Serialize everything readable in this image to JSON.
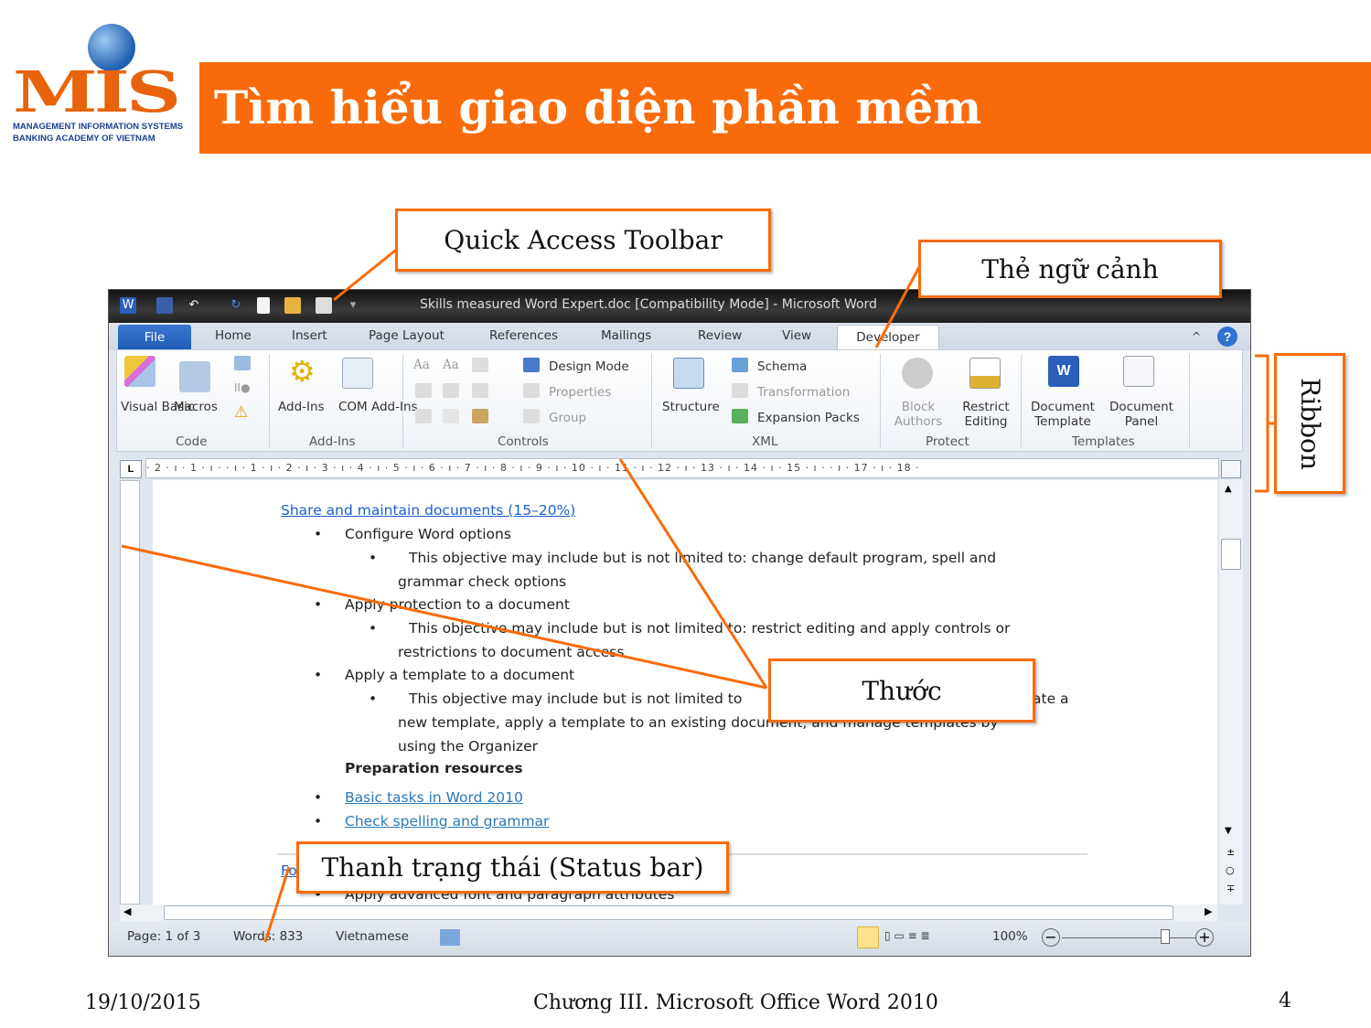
{
  "slide": {
    "title": "Tìm hiểu giao diện phần mềm",
    "footer_date": "19/10/2015",
    "footer_center": "Chương III. Microsoft Office Word 2010",
    "page_number": "4",
    "accent": "#f96b0a"
  },
  "logo": {
    "text": "MIS",
    "line1": "MANAGEMENT INFORMATION SYSTEMS",
    "line2": "BANKING ACADEMY OF VIETNAM"
  },
  "callouts": {
    "qat": "Quick Access Toolbar",
    "contextual": "Thẻ ngữ cảnh",
    "ribbon": "Ribbon",
    "ruler": "Thước",
    "statusbar": "Thanh trạng thái (Status bar)"
  },
  "word": {
    "title": "Skills measured Word Expert.doc [Compatibility Mode]  -  Microsoft Word",
    "qat_icons": [
      "word-icon",
      "save-icon",
      "undo-icon",
      "redo-icon",
      "new-icon",
      "open-icon",
      "print-preview-icon",
      "customize-icon"
    ],
    "tabs": [
      "File",
      "Home",
      "Insert",
      "Page Layout",
      "References",
      "Mailings",
      "Review",
      "View",
      "Developer"
    ],
    "ribbon": {
      "code": {
        "label": "Code",
        "visual_basic": "Visual Basic",
        "macros": "Macros"
      },
      "addins": {
        "label": "Add-Ins",
        "addins": "Add-Ins",
        "com": "COM Add-Ins"
      },
      "controls": {
        "label": "Controls",
        "design_mode": "Design Mode",
        "properties": "Properties",
        "group": "Group",
        "aa1": "Aa",
        "aa2": "Aa"
      },
      "xml": {
        "label": "XML",
        "structure": "Structure",
        "schema": "Schema",
        "transformation": "Transformation",
        "expansion": "Expansion Packs"
      },
      "protect": {
        "label": "Protect",
        "block": "Block Authors",
        "restrict": "Restrict Editing"
      },
      "templates": {
        "label": "Templates",
        "doc_template": "Document Template",
        "doc_panel": "Document Panel"
      }
    },
    "ruler": "· 2 · ı · 1 · ı ·   · ı · 1 · ı · 2 · ı · 3 · ı · 4 · ı · 5 · ı · 6 · ı · 7 · ı · 8 · ı · 9 · ı · 10 · ı · 11 · ı · 12 · ı · 13 · ı · 14 · ı · 15 · ı ·   · ı · 17 · ı · 18 ·",
    "doc": {
      "heading": "Share and maintain documents (15–20%)",
      "b1": "Configure Word options",
      "b1s": "This objective may include but is not limited to: change default program, spell and",
      "b1s2": "grammar check options",
      "b2": "Apply protection to a document",
      "b2s": "This objective may include but is not limited to: restrict editing and apply controls or",
      "b2s2": "restrictions to document access",
      "b3": "Apply a template to a document",
      "b3s": "This objective may include but is not limited to",
      "b3s_end": "ate a",
      "b3s2": "new template, apply a template to an existing document, and manage templates by",
      "b3s3": "using the Organizer",
      "prep": "Preparation resources",
      "l1": "Basic tasks in Word 2010",
      "l2": "Check spelling and grammar",
      "l3": "Fo",
      "last": "Apply advanced font and paragraph attributes"
    },
    "status": {
      "page": "Page: 1 of 3",
      "words": "Words: 833",
      "language": "Vietnamese",
      "zoom": "100%",
      "zoom_percent": 100
    }
  }
}
